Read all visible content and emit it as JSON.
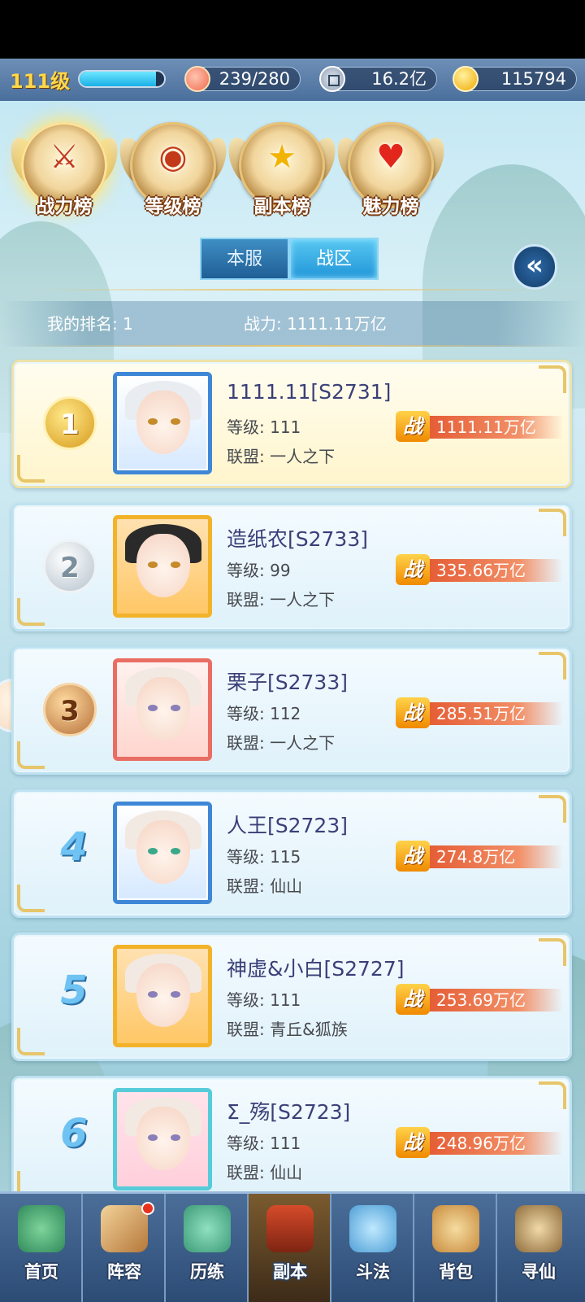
{
  "header": {
    "level": "111级",
    "exp_progress": 0.9,
    "stamina": "239/280",
    "silver": "16.2亿",
    "gold": "115794"
  },
  "categories": [
    {
      "label": "战力榜",
      "icon": "sword-emblem-icon",
      "active": true
    },
    {
      "label": "等级榜",
      "icon": "drum-emblem-icon",
      "active": false
    },
    {
      "label": "副本榜",
      "icon": "stars-emblem-icon",
      "active": false
    },
    {
      "label": "魅力榜",
      "icon": "heart-emblem-icon",
      "active": false
    }
  ],
  "tabs": [
    {
      "label": "本服",
      "active": false
    },
    {
      "label": "战区",
      "active": true
    }
  ],
  "my_rank": {
    "rank_label": "我的排名: 1",
    "power_label": "战力: 1111.11万亿"
  },
  "rows": [
    {
      "rank": "1",
      "name": "1111.11[S2731]",
      "level": "等级: 111",
      "union": "联盟: 一人之下",
      "power": "1111.11万亿",
      "badge": "战"
    },
    {
      "rank": "2",
      "name": "造纸农[S2733]",
      "level": "等级: 99",
      "union": "联盟: 一人之下",
      "power": "335.66万亿",
      "badge": "战"
    },
    {
      "rank": "3",
      "name": "栗子[S2733]",
      "level": "等级: 112",
      "union": "联盟: 一人之下",
      "power": "285.51万亿",
      "badge": "战"
    },
    {
      "rank": "4",
      "name": "人王[S2723]",
      "level": "等级: 115",
      "union": "联盟: 仙山",
      "power": "274.8万亿",
      "badge": "战"
    },
    {
      "rank": "5",
      "name": "神虚&小白[S2727]",
      "level": "等级: 111",
      "union": "联盟: 青丘&狐族",
      "power": "253.69万亿",
      "badge": "战"
    },
    {
      "rank": "6",
      "name": "Σ_殇[S2723]",
      "level": "等级: 111",
      "union": "联盟: 仙山",
      "power": "248.96万亿",
      "badge": "战"
    }
  ],
  "nav": [
    {
      "label": "首页",
      "icon": "home-island-icon"
    },
    {
      "label": "阵容",
      "icon": "cards-icon",
      "badge": true
    },
    {
      "label": "历练",
      "icon": "training-icon"
    },
    {
      "label": "副本",
      "icon": "dungeon-gate-icon",
      "active": true
    },
    {
      "label": "斗法",
      "icon": "battle-sword-icon"
    },
    {
      "label": "背包",
      "icon": "bag-icon"
    },
    {
      "label": "寻仙",
      "icon": "scroll-eye-icon"
    }
  ],
  "colors": {
    "accent_gold": "#e7c56a",
    "power_bar": "#e3562e",
    "name_text": "#3a3f78",
    "tab_active": "#2196d8"
  }
}
